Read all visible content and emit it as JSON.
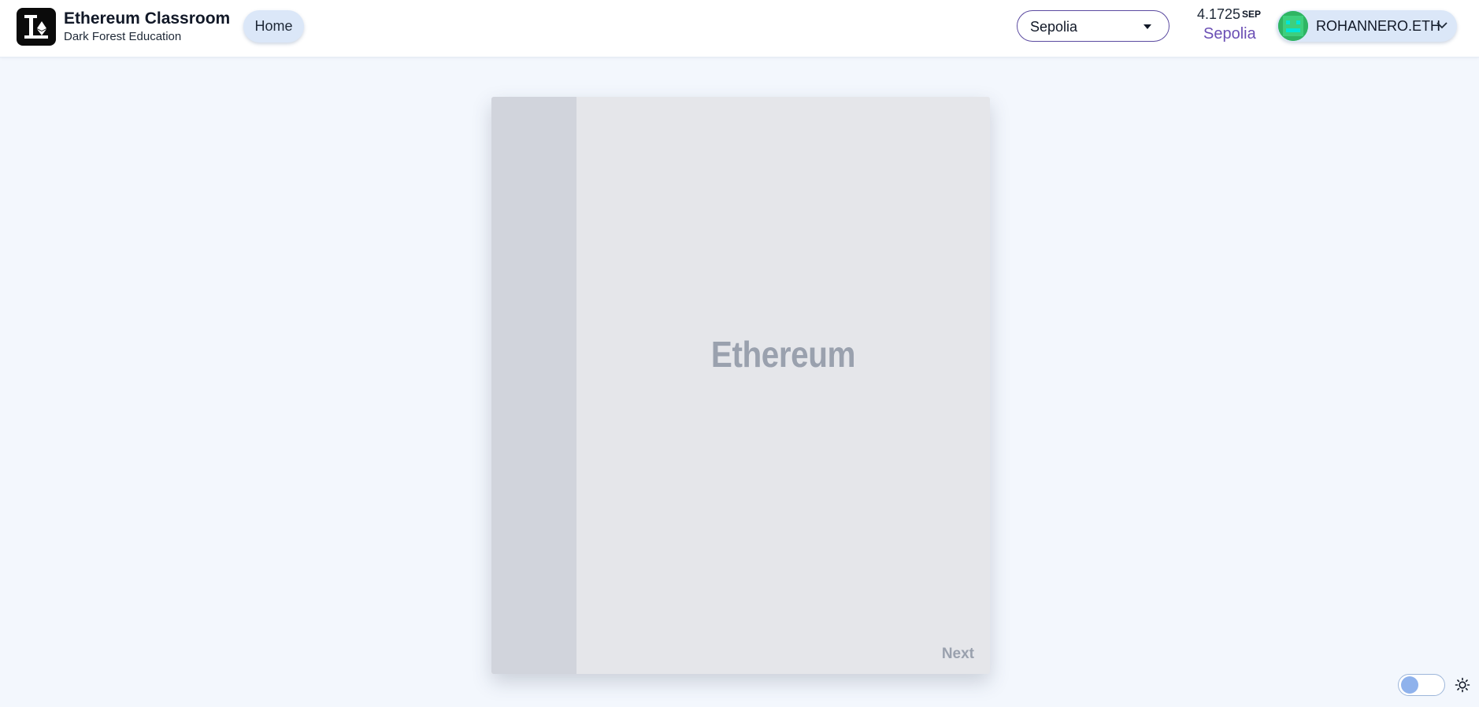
{
  "navbar": {
    "brand_title": "Ethereum Classroom",
    "brand_subtitle": "Dark Forest Education",
    "home_label": "Home",
    "network_select": {
      "selected": "Sepolia"
    },
    "balance": {
      "amount": "4.1725",
      "unit": "SEP",
      "network": "Sepolia"
    },
    "account": {
      "label": "ROHANNERO.ETH"
    }
  },
  "book": {
    "title": "Ethereum",
    "next_label": "Next"
  },
  "theme_toggle": {
    "state": "light"
  },
  "icons": {
    "logo": "ethereum-classroom-logo-icon",
    "network_caret": "caret-down-icon",
    "account_chevron": "chevron-down-icon",
    "theme": "sun-icon"
  },
  "colors": {
    "page_background": "#f3f7fd",
    "accent_purple": "#6b4fb5",
    "button_background": "#dbe7f8",
    "book_cover": "#e5e6ea",
    "book_spine": "#d1d4dc",
    "book_text": "#9aa1ae"
  }
}
